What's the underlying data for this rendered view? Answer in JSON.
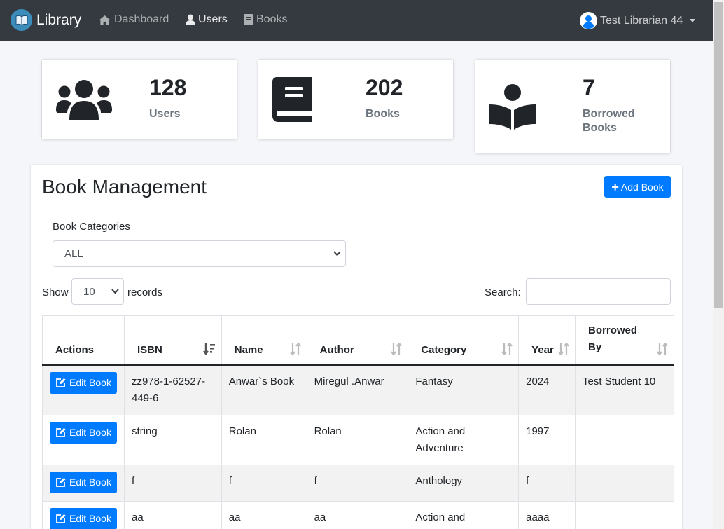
{
  "navbar": {
    "brand": "Library",
    "links": [
      {
        "label": "Dashboard",
        "icon": "home-icon"
      },
      {
        "label": "Users",
        "icon": "user-icon"
      },
      {
        "label": "Books",
        "icon": "book-icon"
      }
    ],
    "user": {
      "name": "Test Librarian 44",
      "icon": "user-avatar-icon"
    }
  },
  "stats": [
    {
      "value": "128",
      "label": "Users",
      "icon": "users-group-icon"
    },
    {
      "value": "202",
      "label": "Books",
      "icon": "book-icon"
    },
    {
      "value": "7",
      "label": "Borrowed Books",
      "icon": "book-reader-icon"
    }
  ],
  "main": {
    "title": "Book Management",
    "add_button": "Add Book",
    "category_label": "Book Categories",
    "category_selected": "ALL",
    "show_prefix": "Show",
    "page_length": "10",
    "show_suffix": "records",
    "search_label": "Search:",
    "search_value": ""
  },
  "table": {
    "columns": [
      "Actions",
      "ISBN",
      "Name",
      "Author",
      "Category",
      "Year",
      "Borrowed By"
    ],
    "edit_label": "Edit Book",
    "rows": [
      {
        "isbn": "zz978-1-62527-449-6",
        "name": "Anwar`s Book",
        "author": "Miregul .Anwar",
        "category": "Fantasy",
        "year": "2024",
        "borrowed_by": "Test Student 10"
      },
      {
        "isbn": "string",
        "name": "Rolan",
        "author": "Rolan",
        "category": "Action and Adventure",
        "year": "1997",
        "borrowed_by": ""
      },
      {
        "isbn": "f",
        "name": "f",
        "author": "f",
        "category": "Anthology",
        "year": "f",
        "borrowed_by": ""
      },
      {
        "isbn": "aa",
        "name": "aa",
        "author": "aa",
        "category": "Action and Adventure",
        "year": "aaaa",
        "borrowed_by": ""
      }
    ]
  },
  "colors": {
    "navbar": "#343a40",
    "primary": "#007bff",
    "brand_logo": "#3c8dbc"
  }
}
